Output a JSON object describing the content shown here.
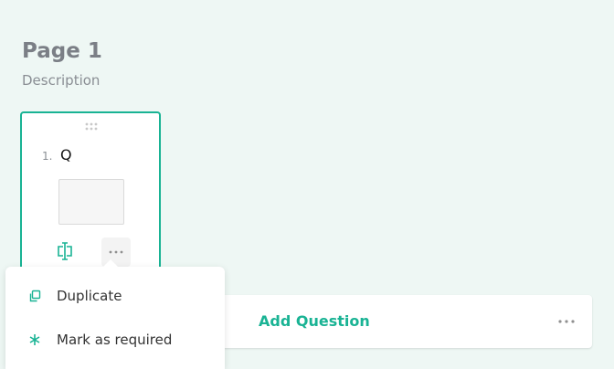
{
  "page": {
    "title": "Page 1",
    "description": "Description"
  },
  "question": {
    "number": "1.",
    "title": "Q"
  },
  "add_question": {
    "label": "Add Question"
  },
  "context_menu": {
    "items": [
      {
        "label": "Duplicate",
        "icon": "duplicate-icon"
      },
      {
        "label": "Mark as required",
        "icon": "required-asterisk-icon"
      }
    ]
  },
  "colors": {
    "accent": "#19b394",
    "background": "#eef7f4"
  }
}
